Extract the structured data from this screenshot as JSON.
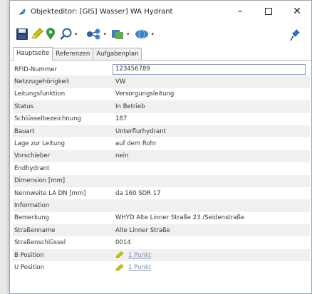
{
  "window": {
    "title": "Objekteditor: [GIS] Wasser] WA Hydrant",
    "minimize": "–",
    "close": "✕"
  },
  "tabs": [
    {
      "label": "Hauptseite",
      "active": true
    },
    {
      "label": "Referenzen",
      "active": false
    },
    {
      "label": "Aufgabenplan",
      "active": false
    }
  ],
  "rows": [
    {
      "label": "RFID-Nummer",
      "value": "123456789"
    },
    {
      "label": "Netzzugehörigkeit",
      "value": "VW"
    },
    {
      "label": "Leitungsfunktion",
      "value": "Versorgungsleitung"
    },
    {
      "label": "Status",
      "value": "In Betrieb"
    },
    {
      "label": "Schlüsselbezeichnung",
      "value": "187"
    },
    {
      "label": "Bauart",
      "value": "Unterflurhydrant"
    },
    {
      "label": "Lage zur Leitung",
      "value": "auf dem Rohr"
    },
    {
      "label": "Vorschieber",
      "value": "nein"
    },
    {
      "label": "Endhydrant",
      "value": ""
    },
    {
      "label": "Dimension [mm]",
      "value": ""
    },
    {
      "label": "Nennweite LA DN [mm]",
      "value": "da 160 SDR 17"
    },
    {
      "label": "Information",
      "value": ""
    },
    {
      "label": "Bemerkung",
      "value": "WHYD Alte Linner Straße 23 /Seidenstraße"
    },
    {
      "label": "Straßenname",
      "value": "Alte Linner Straße"
    },
    {
      "label": "Straßenschlüssel",
      "value": "0014"
    },
    {
      "label": "B Position",
      "value": "1 Punkt"
    },
    {
      "label": "Ü Position",
      "value": "1 Punkt"
    }
  ],
  "colors": {
    "accent": "#2b5e9e",
    "pencil": "#c8c800",
    "link": "#7a8fc4"
  },
  "toolbar_icons": [
    "save-icon",
    "pencil-icon",
    "location-pin-icon",
    "search-icon",
    "network-icon",
    "layers-icon",
    "globe-icon",
    "pin-icon"
  ]
}
